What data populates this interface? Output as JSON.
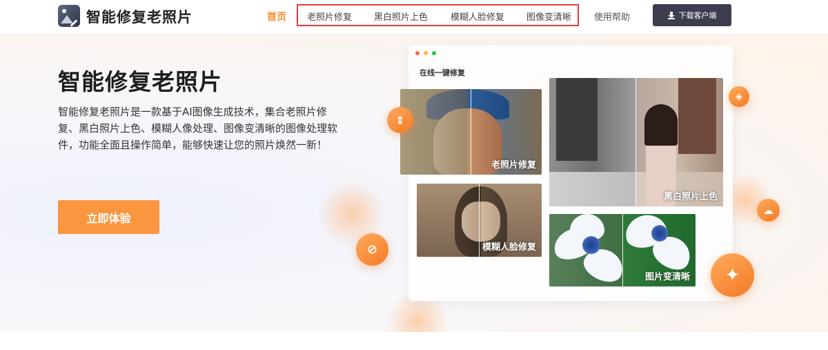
{
  "header": {
    "brand": "智能修复老照片",
    "nav_home": "首页",
    "nav_items": [
      "老照片修复",
      "黑白照片上色",
      "模糊人脸修复",
      "图像变清晰"
    ],
    "help": "使用帮助",
    "download": "下载客户端"
  },
  "hero": {
    "title": "智能修复老照片",
    "description": "智能修复老照片是一款基于AI图像生成技术，集合老照片修复、黑白照片上色、模糊人像处理、图像变清晰的图像处理软件，功能全面且操作简单，能够快速让您的照片焕然一新！",
    "cta": "立即体验"
  },
  "showcase": {
    "window_title": "在线一键修复",
    "cards": [
      "老照片修复",
      "模糊人脸修复",
      "黑白照片上色",
      "图片变清晰"
    ]
  },
  "colors": {
    "accent": "#fa9640",
    "nav_active": "#ff8a2a",
    "highlight_border": "#e63b3b",
    "download_bg": "#3c3e4f"
  },
  "icons": [
    "logo-icon",
    "download-icon",
    "ruler-icon",
    "paint-bucket-icon",
    "eraser-icon",
    "cloud-icon",
    "magic-wand-icon"
  ]
}
